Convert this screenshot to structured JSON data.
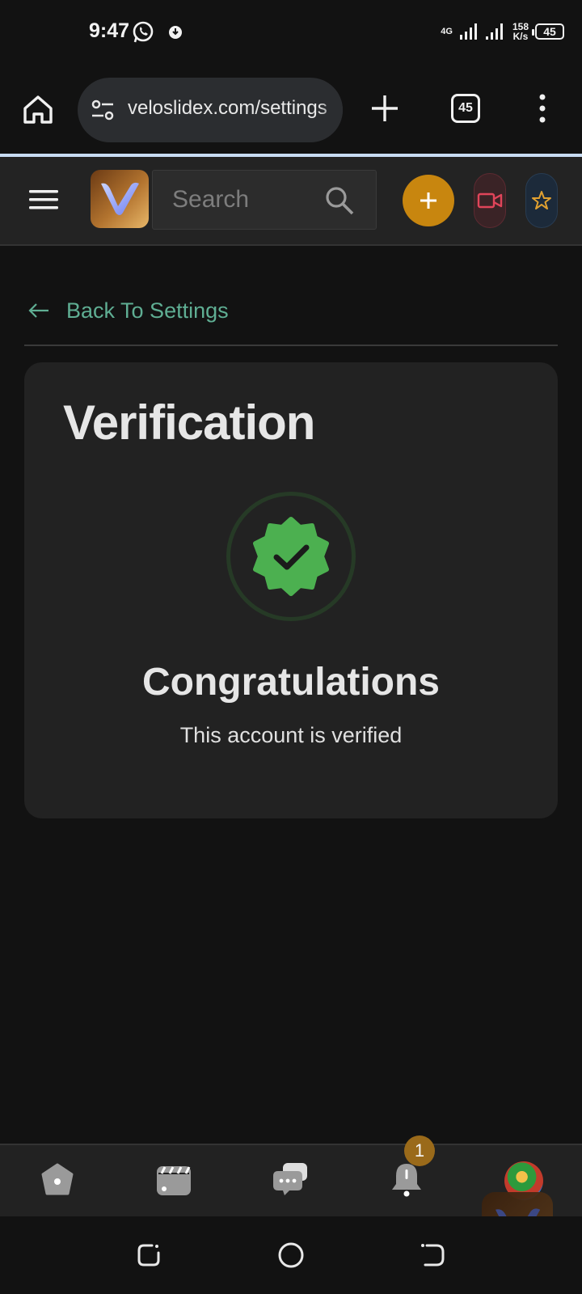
{
  "status_bar": {
    "time": "9:47",
    "network": "4G",
    "speed_value": "158",
    "speed_unit": "K/s",
    "battery": "45"
  },
  "browser": {
    "url": "veloslidex.com/settings",
    "tab_count": "45"
  },
  "site_header": {
    "search_placeholder": "Search"
  },
  "content": {
    "back_label": "Back To Settings",
    "card_title": "Verification",
    "heading": "Congratulations",
    "message": "This account is verified"
  },
  "bottom_nav": {
    "notifications_badge": "1"
  },
  "colors": {
    "background": "#121212",
    "card": "#222222",
    "accent_green": "#4cb050",
    "link_green": "#5fae93",
    "add_button": "#c8860f"
  }
}
